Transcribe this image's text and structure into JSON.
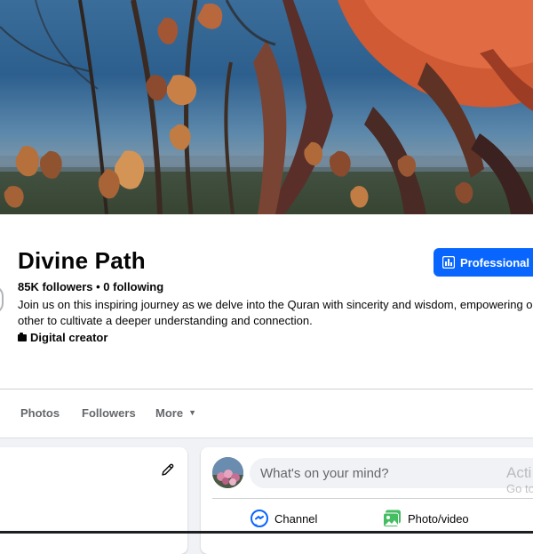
{
  "page": {
    "name": "Divine Path",
    "stats": "85K followers • 0 following",
    "bio_line1": "Join us on this inspiring journey as we delve into the Quran with sincerity and wisdom, empowering o",
    "bio_line2": "other to cultivate a deeper understanding and connection.",
    "category": "Digital creator"
  },
  "actions": {
    "professional_label": "Professional d"
  },
  "tabs": [
    {
      "label": "Photos"
    },
    {
      "label": "Followers"
    },
    {
      "label": "More"
    }
  ],
  "composer": {
    "placeholder": "What's on your mind?",
    "channel_label": "Channel",
    "photo_label": "Photo/video"
  },
  "watermark": {
    "line1": "Acti",
    "line2": "Go to"
  },
  "colors": {
    "accent": "#0866ff",
    "channel": "#0866ff",
    "photo": "#45bd62",
    "page_bg": "#f0f2f5"
  }
}
